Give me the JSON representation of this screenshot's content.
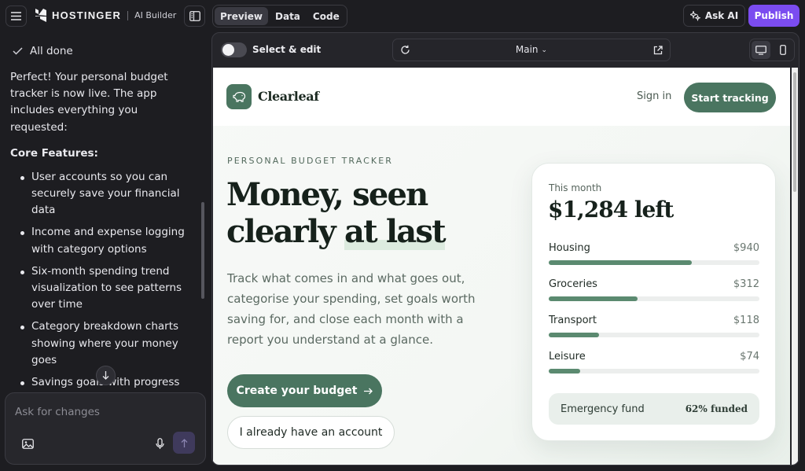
{
  "topbar": {
    "brand": "HOSTINGER",
    "product": "AI Builder",
    "tabs": [
      {
        "label": "Preview",
        "active": true
      },
      {
        "label": "Data",
        "active": false
      },
      {
        "label": "Code",
        "active": false
      }
    ],
    "ask_ai_label": "Ask AI",
    "publish_label": "Publish",
    "publish_color": "#7b4cf0"
  },
  "chat": {
    "status": "All done",
    "intro": "Perfect! Your personal budget tracker is now live. The app includes everything you requested:",
    "features_heading": "Core Features:",
    "features": [
      "User accounts so you can securely save your financial data",
      "Income and expense logging with category options",
      "Six-month spending trend visualization to see patterns over time",
      "Category breakdown charts showing where your money goes",
      "Savings goals with progress tracking toward your targets"
    ],
    "composer_placeholder": "Ask for changes"
  },
  "preview_toolbar": {
    "select_edit_label": "Select & edit",
    "select_edit_on": false,
    "route": "Main"
  },
  "site": {
    "brand": "Clearleaf",
    "signin": "Sign in",
    "start_cta": "Start tracking",
    "eyebrow": "PERSONAL BUDGET TRACKER",
    "title_line1": "Money, seen",
    "title_line2_a": "clearly ",
    "title_line2_b": "at last",
    "description": "Track what comes in and what goes out, categorise your spending, set goals worth saving for, and close each month with a report you understand at a glance.",
    "primary_cta": "Create your budget",
    "secondary_cta": "I already have an account",
    "accent_color": "#4a7560",
    "card": {
      "label": "This month",
      "amount": "$1,284 left",
      "categories": [
        {
          "name": "Housing",
          "amount": "$940",
          "fill": 0.68
        },
        {
          "name": "Groceries",
          "amount": "$312",
          "fill": 0.42
        },
        {
          "name": "Transport",
          "amount": "$118",
          "fill": 0.24
        },
        {
          "name": "Leisure",
          "amount": "$74",
          "fill": 0.15
        }
      ],
      "fund_label": "Emergency fund",
      "fund_value": "62% funded"
    }
  }
}
